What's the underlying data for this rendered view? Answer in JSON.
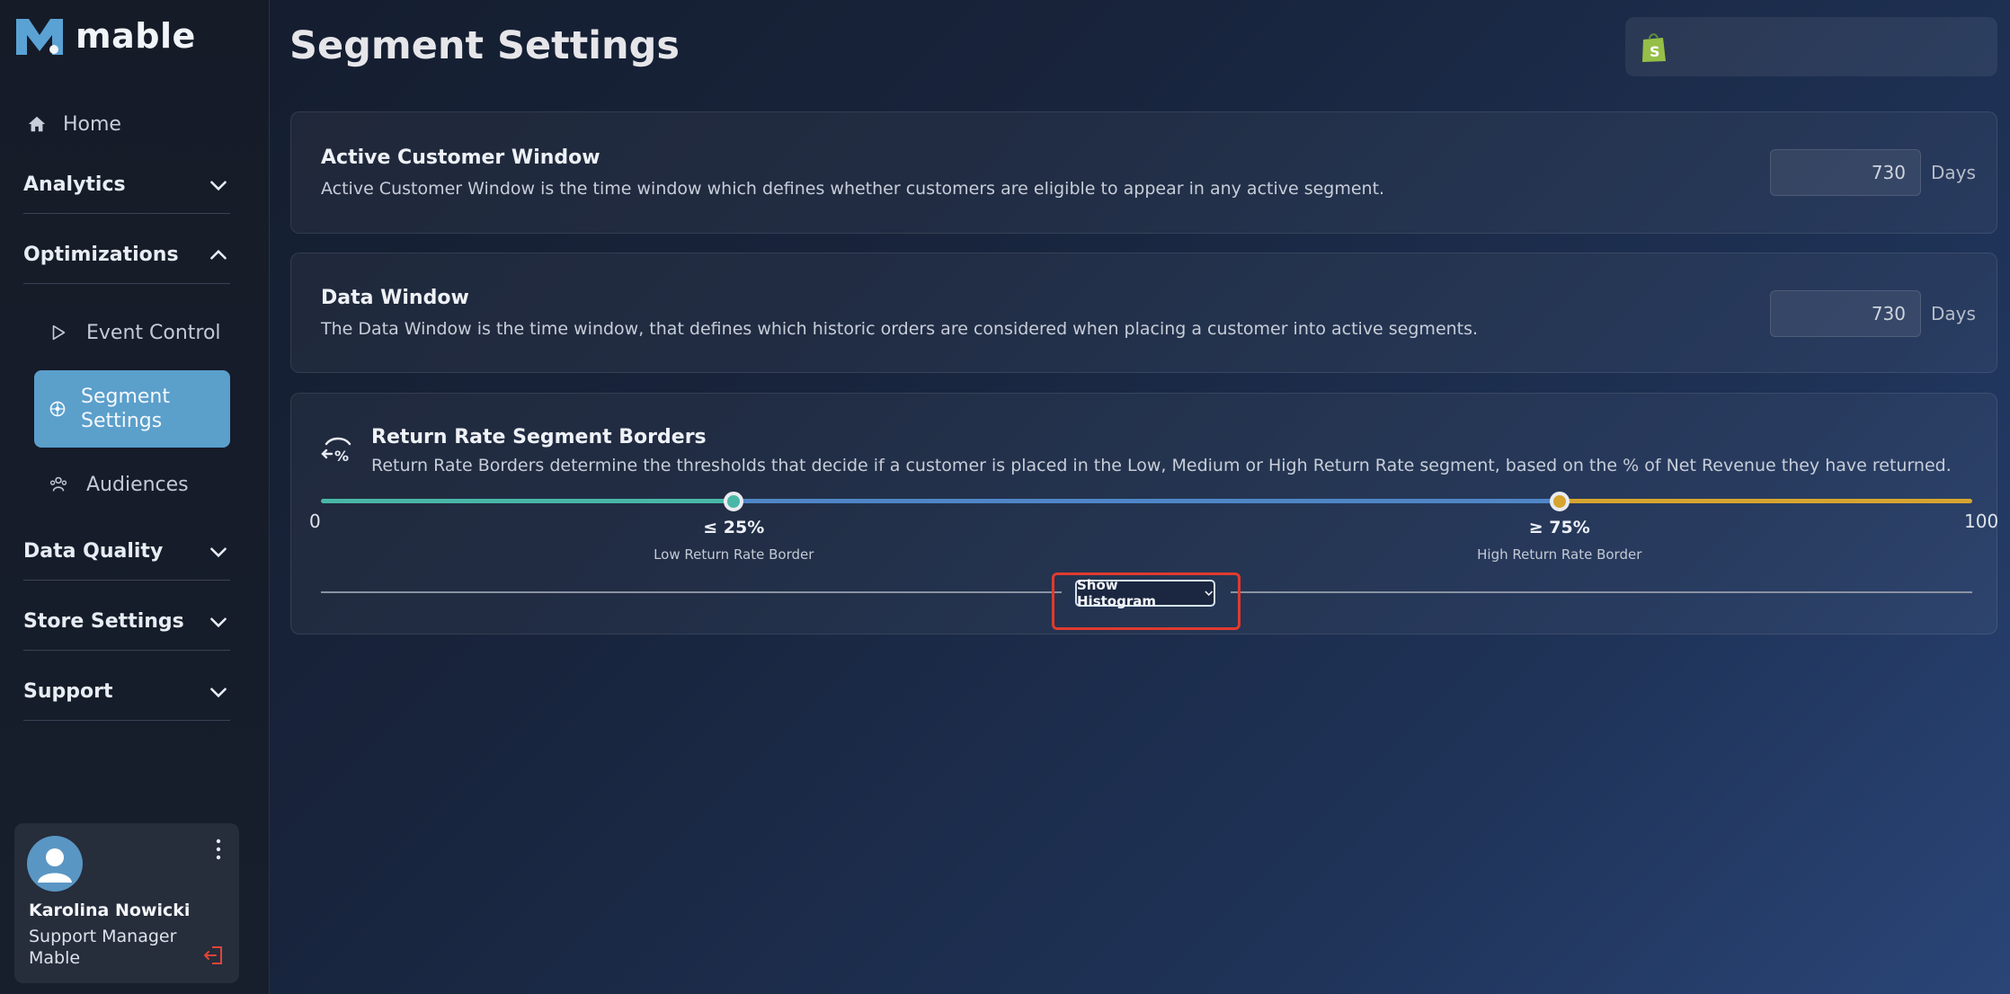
{
  "app": {
    "name": "mable"
  },
  "sidebar": {
    "home_label": "Home",
    "sections": [
      {
        "label": "Analytics",
        "state": "collapsed"
      },
      {
        "label": "Optimizations",
        "state": "expanded"
      },
      {
        "label": "Data Quality",
        "state": "collapsed"
      },
      {
        "label": "Store Settings",
        "state": "collapsed"
      },
      {
        "label": "Support",
        "state": "collapsed"
      }
    ],
    "optimizations_items": [
      {
        "label": "Event Control",
        "icon": "play-outline-icon",
        "active": false
      },
      {
        "label": "Segment Settings",
        "icon": "segment-icon",
        "active": true
      },
      {
        "label": "Audiences",
        "icon": "people-icon",
        "active": false
      }
    ],
    "active_color": "#5b9fcb"
  },
  "user": {
    "name": "Karolina Nowicki",
    "role": "Support Manager",
    "company": "Mable"
  },
  "header": {
    "title": "Segment Settings",
    "store_icon": "shopify-bag-icon"
  },
  "active_customer_window": {
    "title": "Active Customer Window",
    "description": "Active Customer Window is the time window which defines whether customers are eligible to appear in any active segment.",
    "value": "730",
    "unit": "Days"
  },
  "data_window": {
    "title": "Data Window",
    "description": "The Data Window is the time window, that defines which historic orders are considered when placing a customer into active segments.",
    "value": "730",
    "unit": "Days"
  },
  "return_rate": {
    "title": "Return Rate Segment Borders",
    "description": "Return Rate Borders determine the thresholds that decide if a customer is placed in the Low, Medium or High Return Rate segment, based on the % of Net Revenue they have returned.",
    "min_label": "0",
    "max_label": "100",
    "min": 0,
    "max": 100,
    "low_border_value": 25,
    "high_border_value": 75,
    "low_border_text": "≤ 25%",
    "high_border_text": "≥ 75%",
    "low_border_label": "Low Return Rate Border",
    "high_border_label": "High Return Rate Border",
    "colors": {
      "low": "#49b7a8",
      "medium": "#4f86c6",
      "high": "#d6a530"
    },
    "show_histogram_label": "Show Histogram"
  }
}
